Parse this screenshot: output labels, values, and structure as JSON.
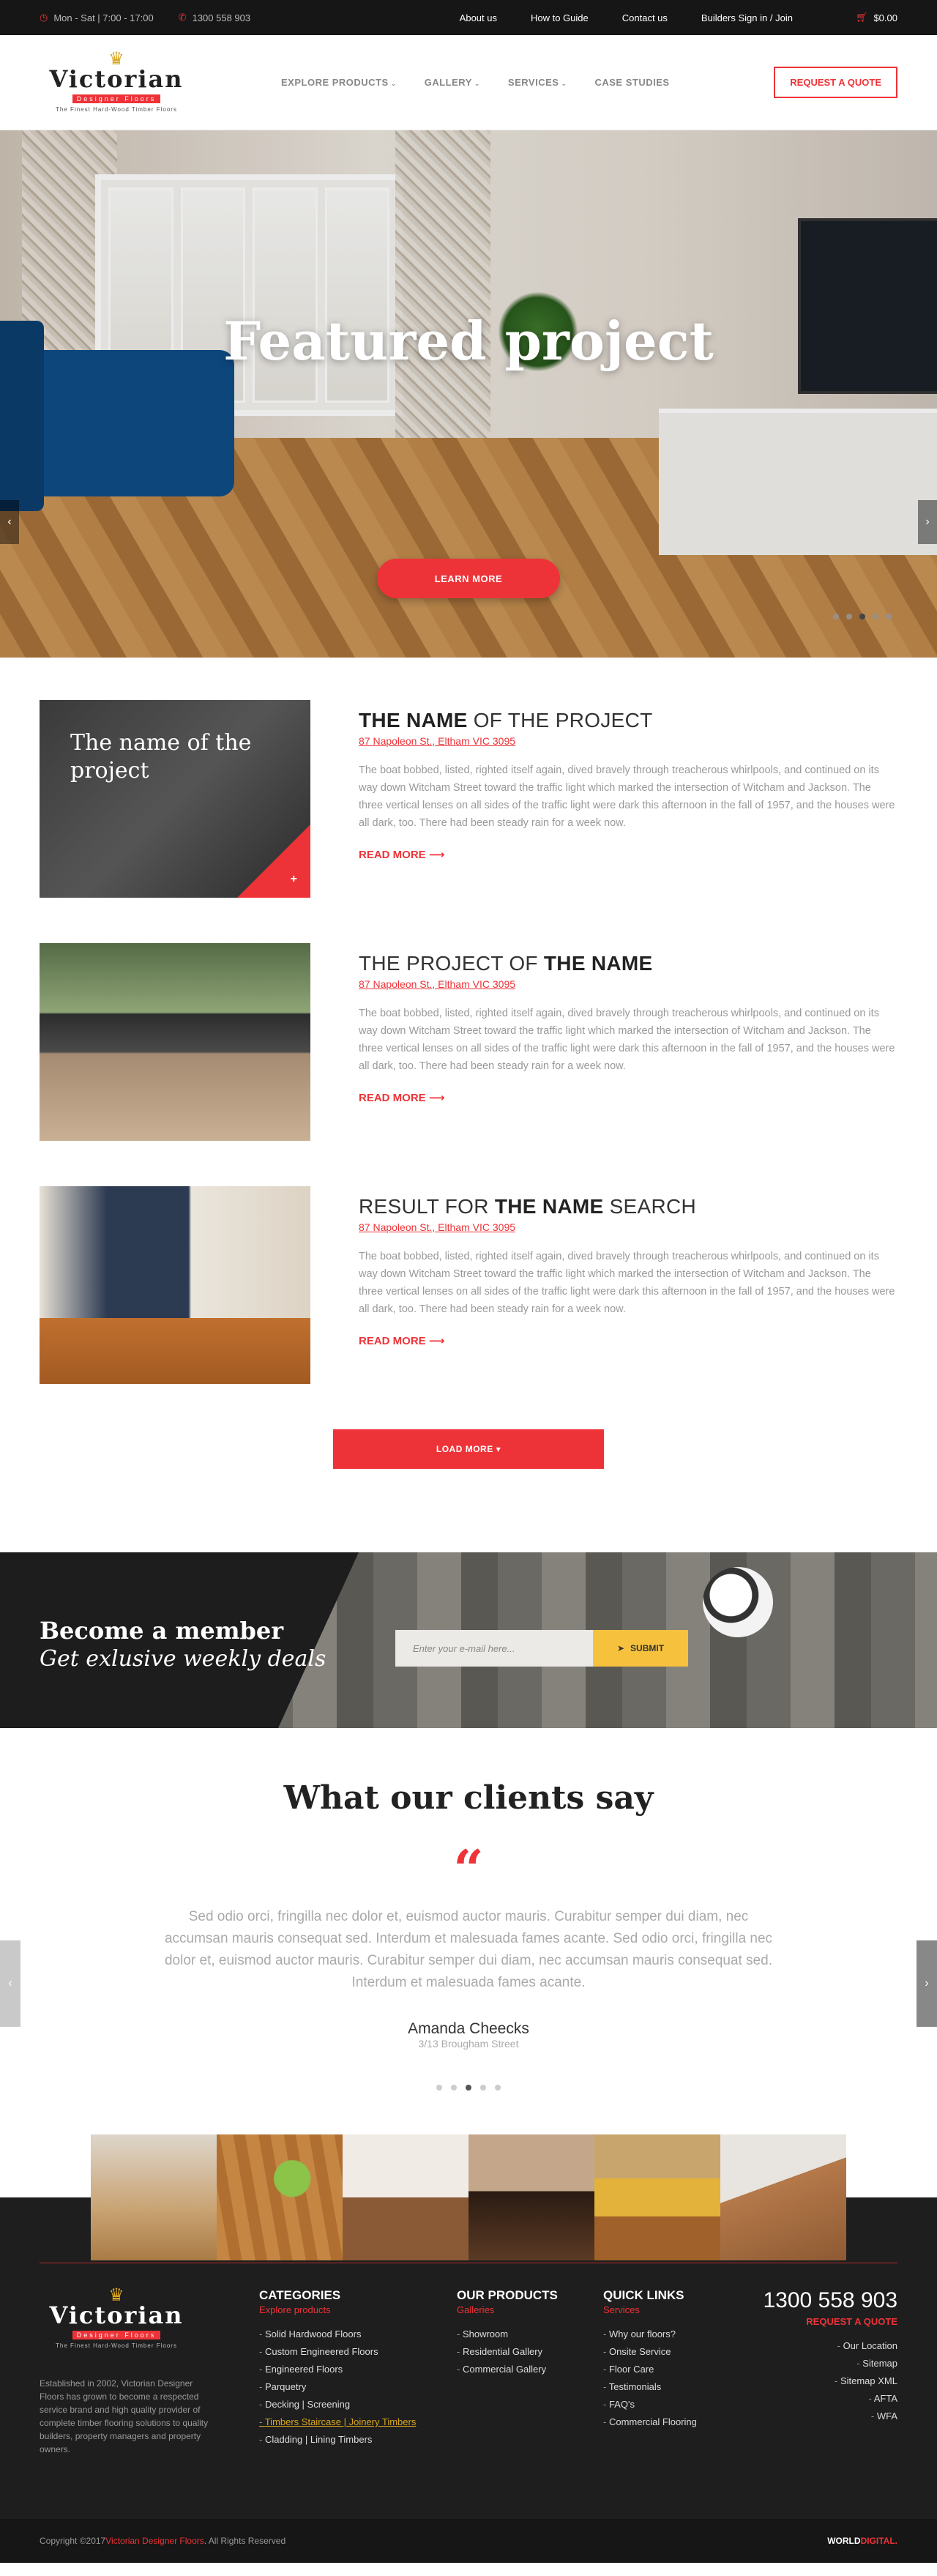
{
  "topbar": {
    "hours": "Mon - Sat | 7:00 - 17:00",
    "phone": "1300 558 903",
    "links": [
      "About us",
      "How to Guide",
      "Contact us",
      "Builders Sign in / Join"
    ],
    "cart": "$0.00"
  },
  "logo": {
    "name": "Victorian",
    "sub1": "Designer Floors",
    "sub2": "The Finest Hard-Wood Timber Floors"
  },
  "nav": {
    "items": [
      "EXPLORE PRODUCTS",
      "GALLERY",
      "SERVICES",
      "CASE STUDIES"
    ],
    "quote": "REQUEST A QUOTE"
  },
  "hero": {
    "title": "Featured project",
    "button": "LEARN MORE"
  },
  "projects": [
    {
      "image_caption": "The name of the project",
      "title_plain_pre": "",
      "title_bold": "THE NAME",
      "title_plain_post": " OF THE PROJECT",
      "address": "87 Napoleon St., Eltham VIC 3095",
      "body": "The boat bobbed, listed, righted itself again, dived bravely through treacherous whirlpools, and continued on its way down Witcham Street toward the traffic light which marked the intersection of Witcham and Jackson. The three vertical lenses on all sides of the traffic light were dark this afternoon in the fall of 1957, and the houses were all dark, too. There had been steady rain for a week now.",
      "more": "READ MORE"
    },
    {
      "title_plain_pre": "THE PROJECT OF ",
      "title_bold": "THE NAME",
      "title_plain_post": "",
      "address": "87 Napoleon St., Eltham VIC 3095",
      "body": "The boat bobbed, listed, righted itself again, dived bravely through treacherous whirlpools, and continued on its way down Witcham Street toward the traffic light which marked the intersection of Witcham and Jackson. The three vertical lenses on all sides of the traffic light were dark this afternoon in the fall of 1957, and the houses were all dark, too. There had been steady rain for a week now.",
      "more": "READ MORE"
    },
    {
      "title_plain_pre": "RESULT FOR ",
      "title_bold": "THE NAME",
      "title_plain_post": " SEARCH",
      "address": "87 Napoleon St., Eltham VIC 3095",
      "body": "The boat bobbed, listed, righted itself again, dived bravely through treacherous whirlpools, and continued on its way down Witcham Street toward the traffic light which marked the intersection of Witcham and Jackson. The three vertical lenses on all sides of the traffic light were dark this afternoon in the fall of 1957, and the houses were all dark, too. There had been steady rain for a week now.",
      "more": "READ MORE"
    }
  ],
  "loadmore": "LOAD MORE",
  "member": {
    "line1": "Become a member",
    "line2": "Get exlusive weekly deals",
    "placeholder": "Enter your e-mail here...",
    "submit": "SUBMIT"
  },
  "testimonials": {
    "title": "What our clients say",
    "quote": "Sed odio orci, fringilla nec dolor et, euismod auctor mauris. Curabitur semper dui diam, nec accumsan mauris consequat sed. Interdum et malesuada fames acante. Sed odio orci, fringilla nec dolor et, euismod auctor mauris. Curabitur semper dui diam, nec accumsan mauris consequat sed. Interdum et malesuada fames acante.",
    "name": "Amanda Cheecks",
    "address": "3/13 Brougham Street"
  },
  "footer": {
    "about": "Established in 2002, Victorian Designer Floors has grown to become a respected service brand and high quality provider of complete timber flooring solutions to quality builders, property managers and property owners.",
    "categories": {
      "title": "CATEGORIES",
      "sub": "Explore products",
      "items": [
        "Solid Hardwood Floors",
        "Custom Engineered Floors",
        "Engineered Floors",
        "Parquetry",
        "Decking | Screening",
        "Timbers Staircase | Joinery Timbers",
        "Cladding | Lining Timbers"
      ]
    },
    "products": {
      "title": "OUR PRODUCTS",
      "sub": "Galleries",
      "items": [
        "Showroom",
        "Residential Gallery",
        "Commercial Gallery"
      ]
    },
    "quicklinks": {
      "title": "QUICK LINKS",
      "sub": "Services",
      "items": [
        "Why our floors?",
        "Onsite Service",
        "Floor Care",
        "Testimonials",
        "FAQ's",
        "Commercial Flooring"
      ]
    },
    "phone": "1300 558 903",
    "request": "REQUEST A QUOTE",
    "links": [
      "Our Location",
      "Sitemap",
      "Sitemap XML",
      "AFTA",
      "WFA"
    ]
  },
  "copyright": {
    "pre": "Copyright ©2017 ",
    "brand": "Victorian Designer Floors",
    "post": ". All Rights Reserved",
    "maker_a": "WORLD",
    "maker_b": "DIGITAL."
  }
}
